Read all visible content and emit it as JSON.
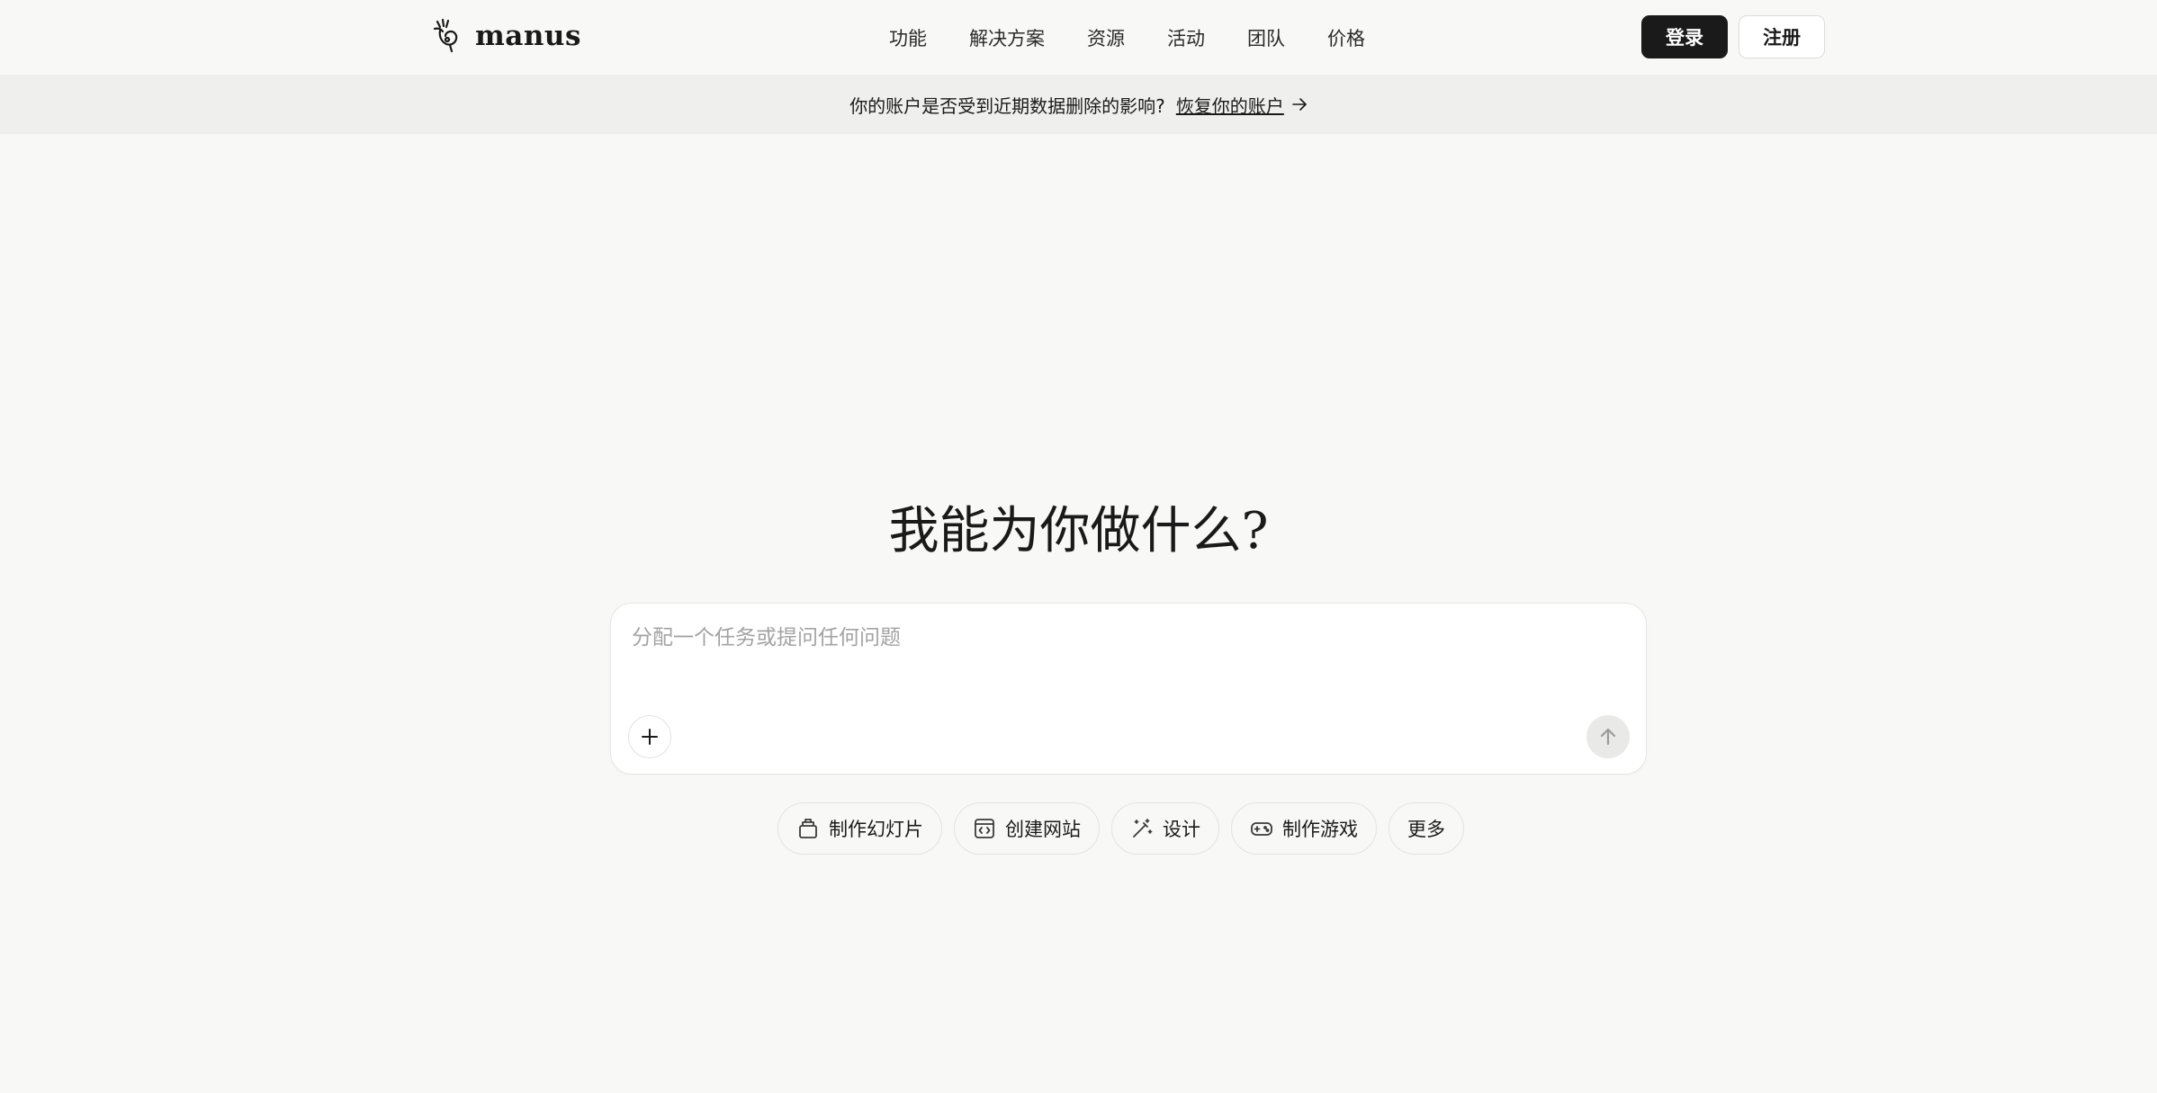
{
  "brand": {
    "name": "manus"
  },
  "nav": {
    "items": [
      {
        "label": "功能"
      },
      {
        "label": "解决方案"
      },
      {
        "label": "资源"
      },
      {
        "label": "活动"
      },
      {
        "label": "团队"
      },
      {
        "label": "价格"
      }
    ]
  },
  "auth": {
    "login_label": "登录",
    "register_label": "注册"
  },
  "banner": {
    "text": "你的账户是否受到近期数据删除的影响?",
    "link_label": "恢复你的账户",
    "arrow_icon": "arrow-right-icon"
  },
  "main": {
    "title": "我能为你做什么?",
    "composer": {
      "placeholder": "分配一个任务或提问任何问题",
      "value": ""
    }
  },
  "chips": [
    {
      "label": "制作幻灯片",
      "icon": "slides-icon"
    },
    {
      "label": "创建网站",
      "icon": "website-code-icon"
    },
    {
      "label": "设计",
      "icon": "design-wand-icon"
    },
    {
      "label": "制作游戏",
      "icon": "gamepad-icon"
    },
    {
      "label": "更多"
    }
  ],
  "colors": {
    "background": "#f8f8f7",
    "banner_background": "#efefee",
    "primary_button": "#1a1a1a",
    "send_button": "#e9e9e8"
  }
}
